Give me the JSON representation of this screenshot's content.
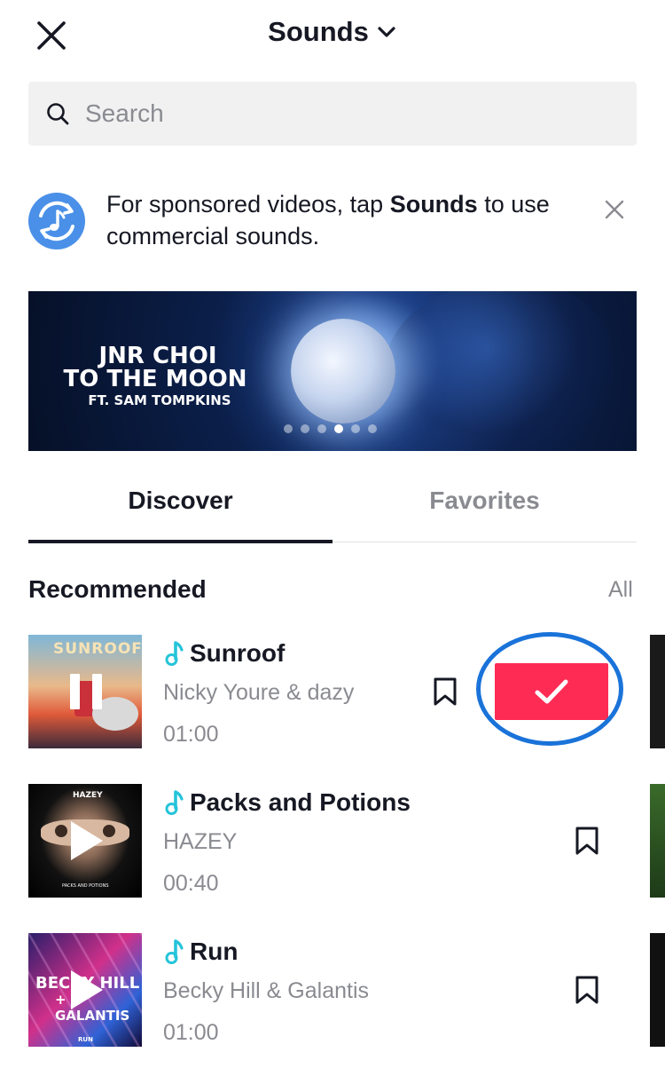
{
  "header": {
    "title": "Sounds"
  },
  "search": {
    "placeholder": "Search"
  },
  "notice": {
    "text_before": "For sponsored videos, tap ",
    "text_bold": "Sounds",
    "text_after": " to use commercial sounds."
  },
  "banner": {
    "line1": "JNR CHOI",
    "line2": "TO THE MOON",
    "line3": "FT. SAM TOMPKINS",
    "page_count": 6,
    "active_page": 4
  },
  "tabs": [
    {
      "label": "Discover",
      "selected": true
    },
    {
      "label": "Favorites",
      "selected": false
    }
  ],
  "section": {
    "title": "Recommended",
    "all_label": "All"
  },
  "songs": [
    {
      "title": "Sunroof",
      "artist": "Nicky Youre & dazy",
      "duration": "01:00",
      "state": "playing",
      "cover_text": "SUNROOF",
      "use_button": "selected"
    },
    {
      "title": "Packs and Potions",
      "artist": "HAZEY",
      "duration": "00:40",
      "state": "paused",
      "cover_text": "HAZEY",
      "cover_subtext": "PACKS AND POTIONS"
    },
    {
      "title": "Run",
      "artist": "Becky Hill & Galantis",
      "duration": "01:00",
      "state": "paused",
      "cover_text": "BECKY HILL",
      "cover_text2": "+ GALANTIS",
      "cover_subtext": "RUN"
    }
  ],
  "colors": {
    "accent": "#fe2c55",
    "note_icon": "#25c4d9",
    "highlight": "#1a73d9",
    "notice_icon_bg": "#4a90e8"
  }
}
